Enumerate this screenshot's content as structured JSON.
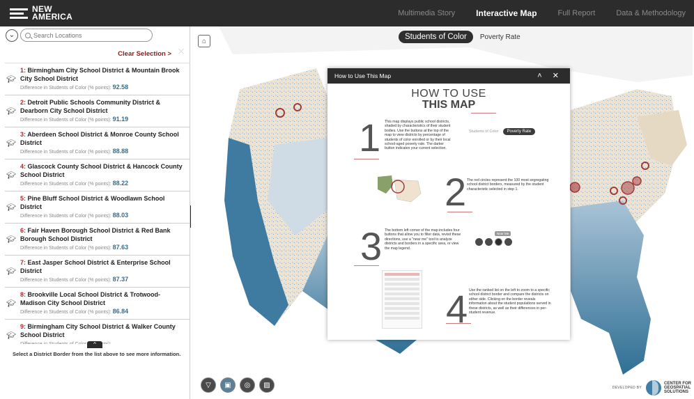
{
  "header": {
    "logo_line1": "NEW",
    "logo_line2": "AMERICA",
    "nav": [
      {
        "label": "Multimedia Story"
      },
      {
        "label": "Interactive Map"
      },
      {
        "label": "Full Report"
      },
      {
        "label": "Data & Methodology"
      }
    ],
    "active_nav": "Interactive Map"
  },
  "sidebar": {
    "search_placeholder": "Search Locations",
    "clear_label": "Clear Selection >",
    "clear_icon": "close-icon",
    "diff_label": "Difference in Students of Color (% points):",
    "items": [
      {
        "rank": "1:",
        "title": "Birmingham City School District  & Mountain Brook City School District",
        "value": "92.58"
      },
      {
        "rank": "2:",
        "title": "Detroit Public Schools Community District  & Dearborn City School District",
        "value": "91.19"
      },
      {
        "rank": "3:",
        "title": "Aberdeen School District  & Monroe County School District",
        "value": "88.88"
      },
      {
        "rank": "4:",
        "title": "Glascock County School District  & Hancock County School District",
        "value": "88.22"
      },
      {
        "rank": "5:",
        "title": "Pine Bluff School District  & Woodlawn School District",
        "value": "88.03"
      },
      {
        "rank": "6:",
        "title": "Fair Haven Borough School District  & Red Bank Borough School District",
        "value": "87.63"
      },
      {
        "rank": "7:",
        "title": "East Jasper School District  & Enterprise School District",
        "value": "87.37"
      },
      {
        "rank": "8:",
        "title": "Brookville Local School District  & Trotwood-Madison City School District",
        "value": "86.84"
      },
      {
        "rank": "9:",
        "title": "Birmingham City School District  & Walker County School District",
        "value": ""
      }
    ],
    "select_msg": "Select a District Border from the list above to see more information."
  },
  "map": {
    "toggle_active": "Students of Color",
    "toggle_inactive": "Poverty Rate",
    "tools": [
      "filter-icon",
      "image-icon",
      "near-me-icon",
      "legend-icon"
    ],
    "active_tool": 1,
    "developed_by": "DEVELOPED BY",
    "credit": [
      "CENTER FOR",
      "GEOSPATIAL",
      "SOLUTIONS"
    ],
    "colors": {
      "light": "#efe3cf",
      "mid": "#a9c3d6",
      "dark": "#2f6f95",
      "marker": "#a33a3a"
    }
  },
  "modal": {
    "header": "How to Use This Map",
    "title1": "HOW TO USE",
    "title2": "THIS MAP",
    "step1_num": "1",
    "step1_text": "This map displays public school districts, shaded by characteristics of their student bodies. Use the buttons at the top of the map to view districts by percentage of students of color enrolled or by their local school-aged poverty rate. The darker button indicates your current selection.",
    "mini_toggle_a": "Students of Color",
    "mini_toggle_b": "Poverty Rate",
    "step2_num": "2",
    "step2_text": "The red circles represent the 100 most segregating school district borders, measured by the student characteristic selected in step 1.",
    "step3_num": "3",
    "step3_text": "The bottom left corner of the map includes four buttons that allow you to filter data, revisit these directions, use a \"near me\" tool to analyze districts and borders in a specific area, or view the map legend.",
    "near_me": "Near Me",
    "step4_num": "4",
    "step4_text": "Use the ranked list on the left to zoom to a specific school district border and compare the districts on either side. Clicking on the border reveals information about the student populations served in these districts, as well as their differences in per-student revenue."
  }
}
